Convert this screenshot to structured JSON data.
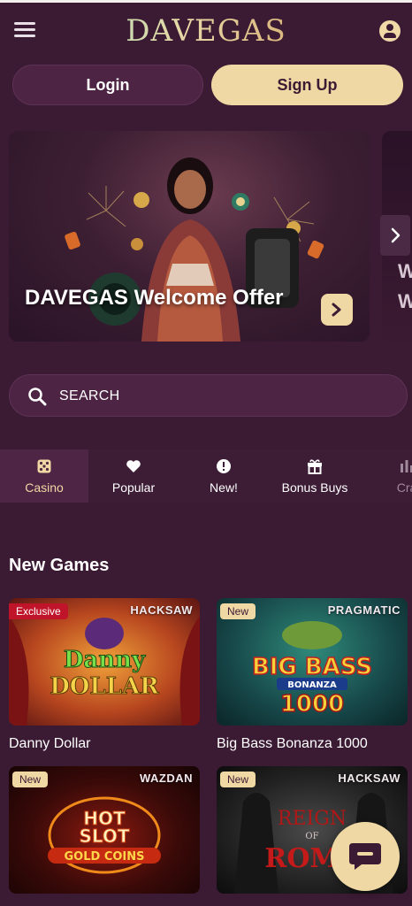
{
  "header": {
    "logo_text": "DAVEGAS"
  },
  "auth": {
    "login_label": "Login",
    "signup_label": "Sign Up"
  },
  "banner": {
    "title": "DAVEGAS Welcome Offer",
    "next_card_letters": [
      "W",
      "W"
    ]
  },
  "search": {
    "placeholder": "SEARCH"
  },
  "categories": [
    {
      "label": "Casino",
      "icon": "dice-icon",
      "active": true
    },
    {
      "label": "Popular",
      "icon": "heart-icon",
      "active": false
    },
    {
      "label": "New!",
      "icon": "alert-badge-icon",
      "active": false
    },
    {
      "label": "Bonus Buys",
      "icon": "gift-icon",
      "active": false
    },
    {
      "label": "Cra",
      "icon": "crash-icon",
      "active": false
    }
  ],
  "new_games": {
    "title": "New Games",
    "games": [
      {
        "name": "Danny Dollar",
        "provider": "HACKSAW",
        "badge": "Exclusive",
        "art_text": "Danny DOLLAR"
      },
      {
        "name": "Big Bass Bonanza 1000",
        "provider": "PRAGMATIC",
        "badge": "New",
        "art_text": "BIG BASS BONANZA 1000"
      },
      {
        "name": "",
        "provider": "WAZDAN",
        "badge": "New",
        "art_text": "HOT SLOT GOLD COINS"
      },
      {
        "name": "",
        "provider": "HACKSAW",
        "badge": "New",
        "art_text": "REIGN OF ROME"
      }
    ]
  },
  "colors": {
    "background": "#3b1a33",
    "accent_gold": "#efd8a4",
    "exclusive_red": "#c0142b"
  }
}
